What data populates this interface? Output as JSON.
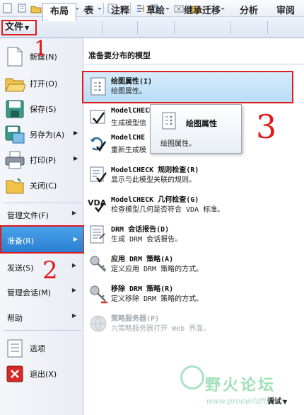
{
  "ribbon": {
    "file_label": "文件",
    "tabs": [
      "布局",
      "表",
      "注释",
      "草绘",
      "继承迁移",
      "分析",
      "审阅"
    ]
  },
  "left_menu": {
    "icon_items": [
      {
        "label": "新建(N)",
        "icon": "new-document-icon"
      },
      {
        "label": "打开(O)",
        "icon": "open-folder-icon"
      },
      {
        "label": "保存(S)",
        "icon": "save-disk-icon"
      },
      {
        "label": "另存为(A)",
        "icon": "save-as-icon"
      },
      {
        "label": "打印(P)",
        "icon": "printer-icon"
      },
      {
        "label": "关闭(C)",
        "icon": "close-folder-icon"
      }
    ],
    "text_items": [
      {
        "label": "管理文件(F)"
      },
      {
        "label": "准备(R)"
      },
      {
        "label": "发送(S)"
      },
      {
        "label": "管理会话(M)"
      },
      {
        "label": "帮助"
      }
    ],
    "bottom_items": [
      {
        "label": "选项",
        "icon": "options-icon"
      },
      {
        "label": "退出(X)",
        "icon": "exit-icon"
      }
    ]
  },
  "panel": {
    "title": "准备要分布的模型",
    "items": [
      {
        "title": "绘图属性(I)",
        "desc": "绘图属性。",
        "icon": "drawing-properties-icon"
      },
      {
        "title": "ModelCHECK",
        "desc": "生成模型信 (零件、装",
        "icon": "modelcheck-icon"
      },
      {
        "title": "ModelCHE",
        "desc": "重新生成模",
        "icon": "modelcheck-regenerate-icon"
      },
      {
        "title": "ModelCHECK 规则检查(R)",
        "desc": "显示与此模型关联的规则。",
        "icon": "rule-check-icon"
      },
      {
        "title": "ModelCHECK 几何检查(G)",
        "desc": "检查模型几何是否符合 VDA 标准。",
        "icon": "vda-check-icon"
      },
      {
        "title": "DRM 会话报告(D)",
        "desc": "生成 DRM 会话报告。",
        "icon": "drm-report-icon"
      },
      {
        "title": "应用 DRM 策略(A)",
        "desc": "定义应用 DRM 策略的方式。",
        "icon": "apply-drm-key-icon"
      },
      {
        "title": "移除 DRM 策略(R)",
        "desc": "定义移除 DRM 策略的方式。",
        "icon": "remove-drm-key-icon"
      },
      {
        "title": "策略服务器(P)",
        "desc": "为策略服务器打开 Web 界面。",
        "icon": "policy-server-icon"
      }
    ]
  },
  "tooltip": {
    "title": "绘图属性",
    "desc": "绘图属性。"
  },
  "annotations": {
    "one": "1",
    "two": "2",
    "three": "3"
  },
  "footer": {
    "debug_label": "调试"
  },
  "watermark": {
    "text": "野火论坛",
    "url": "www.proewildfire.cn"
  },
  "colors": {
    "highlight_border": "#e01b1b",
    "selected_bg": "#2a7fd1"
  }
}
